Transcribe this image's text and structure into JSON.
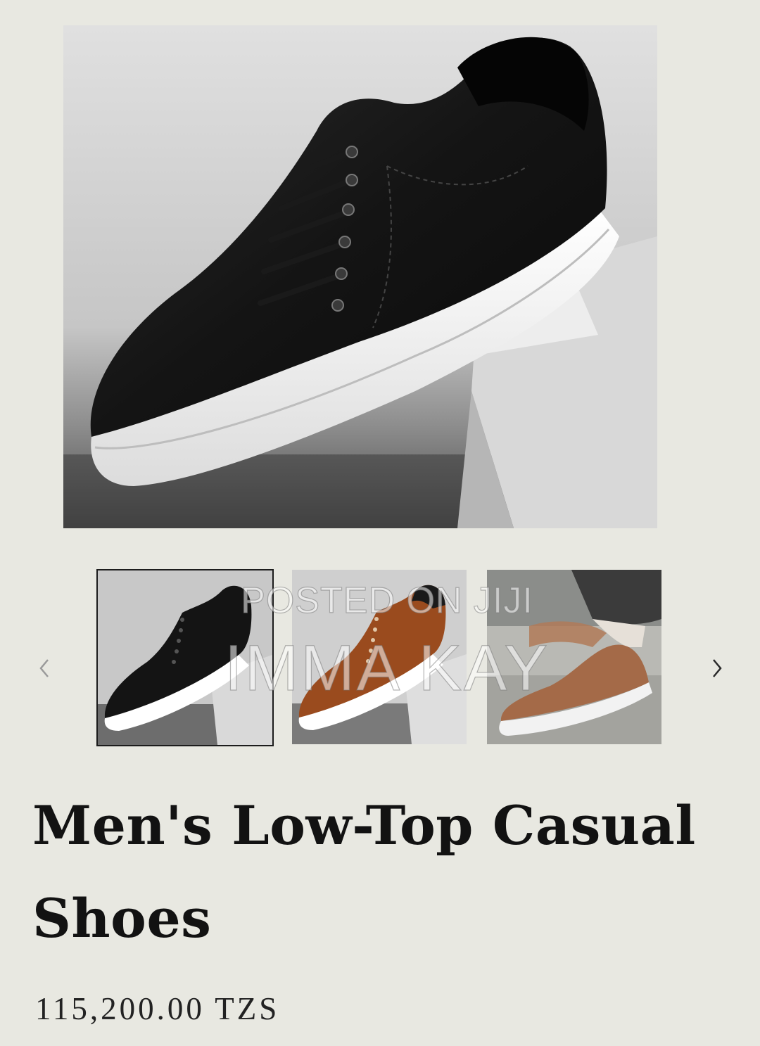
{
  "product": {
    "title": "Men's Low-Top Casual Shoes",
    "price": "115,200.00 TZS"
  },
  "gallery": {
    "main_image": "black-leather-sneaker-photo",
    "thumbnails": [
      {
        "image": "black-sneaker-thumbnail",
        "selected": true
      },
      {
        "image": "brown-sneaker-thumbnail",
        "selected": false
      },
      {
        "image": "tan-sneaker-worn-thumbnail",
        "selected": false
      }
    ],
    "prev_icon": "chevron-left-icon",
    "next_icon": "chevron-right-icon"
  },
  "watermark": {
    "line1": "POSTED ON JIJI",
    "line2": "IMMA KAY"
  },
  "colors": {
    "background": "#e8e8e1",
    "text": "#121212",
    "selected_border": "#1c1c1c"
  }
}
